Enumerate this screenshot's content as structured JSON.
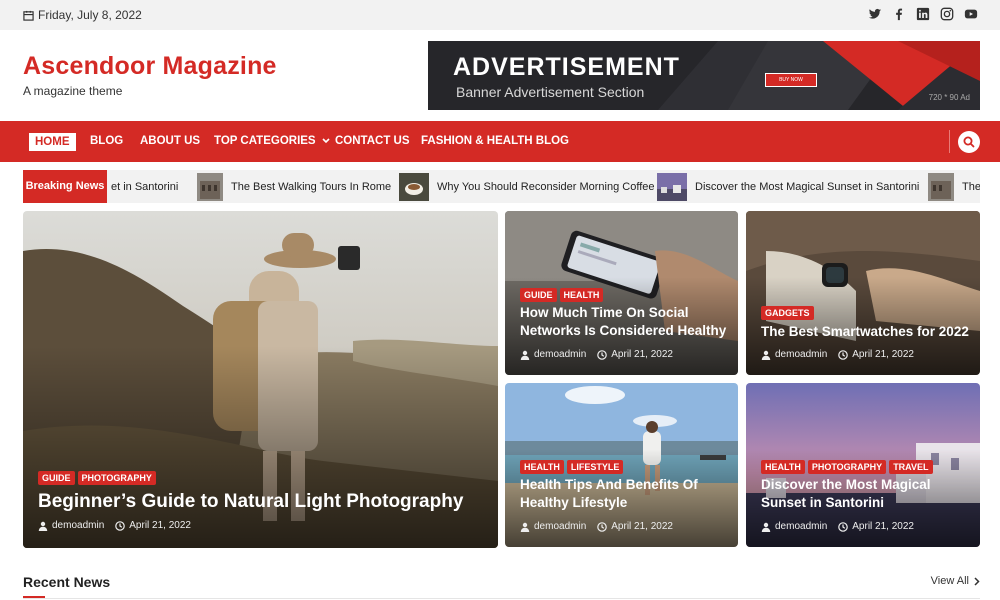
{
  "topbar": {
    "date": "Friday, July 8, 2022",
    "social": [
      "twitter-icon",
      "facebook-icon",
      "linkedin-icon",
      "instagram-icon",
      "youtube-icon"
    ]
  },
  "brand": {
    "title": "Ascendoor Magazine",
    "tagline": "A magazine theme"
  },
  "ad": {
    "title": "ADVERTISEMENT",
    "subtitle": "Banner Advertisement Section",
    "button": "BUY NOW",
    "size": "720 * 90 Ad"
  },
  "nav": {
    "items": [
      "HOME",
      "BLOG",
      "ABOUT US",
      "TOP CATEGORIES",
      "CONTACT US",
      "FASHION & HEALTH BLOG"
    ]
  },
  "ticker": {
    "label": "Breaking News",
    "items": [
      "et in Santorini",
      "The Best Walking Tours In Rome",
      "Why You Should Reconsider Morning Coffee",
      "Discover the Most Magical Sunset in Santorini",
      "The"
    ]
  },
  "featured": {
    "main": {
      "categories": [
        "GUIDE",
        "PHOTOGRAPHY"
      ],
      "title": "Beginner’s Guide to Natural Light Photography",
      "author": "demoadmin",
      "date": "April 21, 2022"
    },
    "grid": [
      {
        "categories": [
          "GUIDE",
          "HEALTH"
        ],
        "title": "How Much Time On Social Networks Is Considered Healthy",
        "author": "demoadmin",
        "date": "April 21, 2022"
      },
      {
        "categories": [
          "GADGETS"
        ],
        "title": "The Best Smartwatches for 2022",
        "author": "demoadmin",
        "date": "April 21, 2022"
      },
      {
        "categories": [
          "HEALTH",
          "LIFESTYLE"
        ],
        "title": "Health Tips And Benefits Of Healthy Lifestyle",
        "author": "demoadmin",
        "date": "April 21, 2022"
      },
      {
        "categories": [
          "HEALTH",
          "PHOTOGRAPHY",
          "TRAVEL"
        ],
        "title": "Discover the Most Magical Sunset in Santorini",
        "author": "demoadmin",
        "date": "April 21, 2022"
      }
    ]
  },
  "recent": {
    "title": "Recent News",
    "view_all": "View All"
  },
  "colors": {
    "accent": "#d42a25",
    "topbar_bg": "#f2f2f2"
  }
}
